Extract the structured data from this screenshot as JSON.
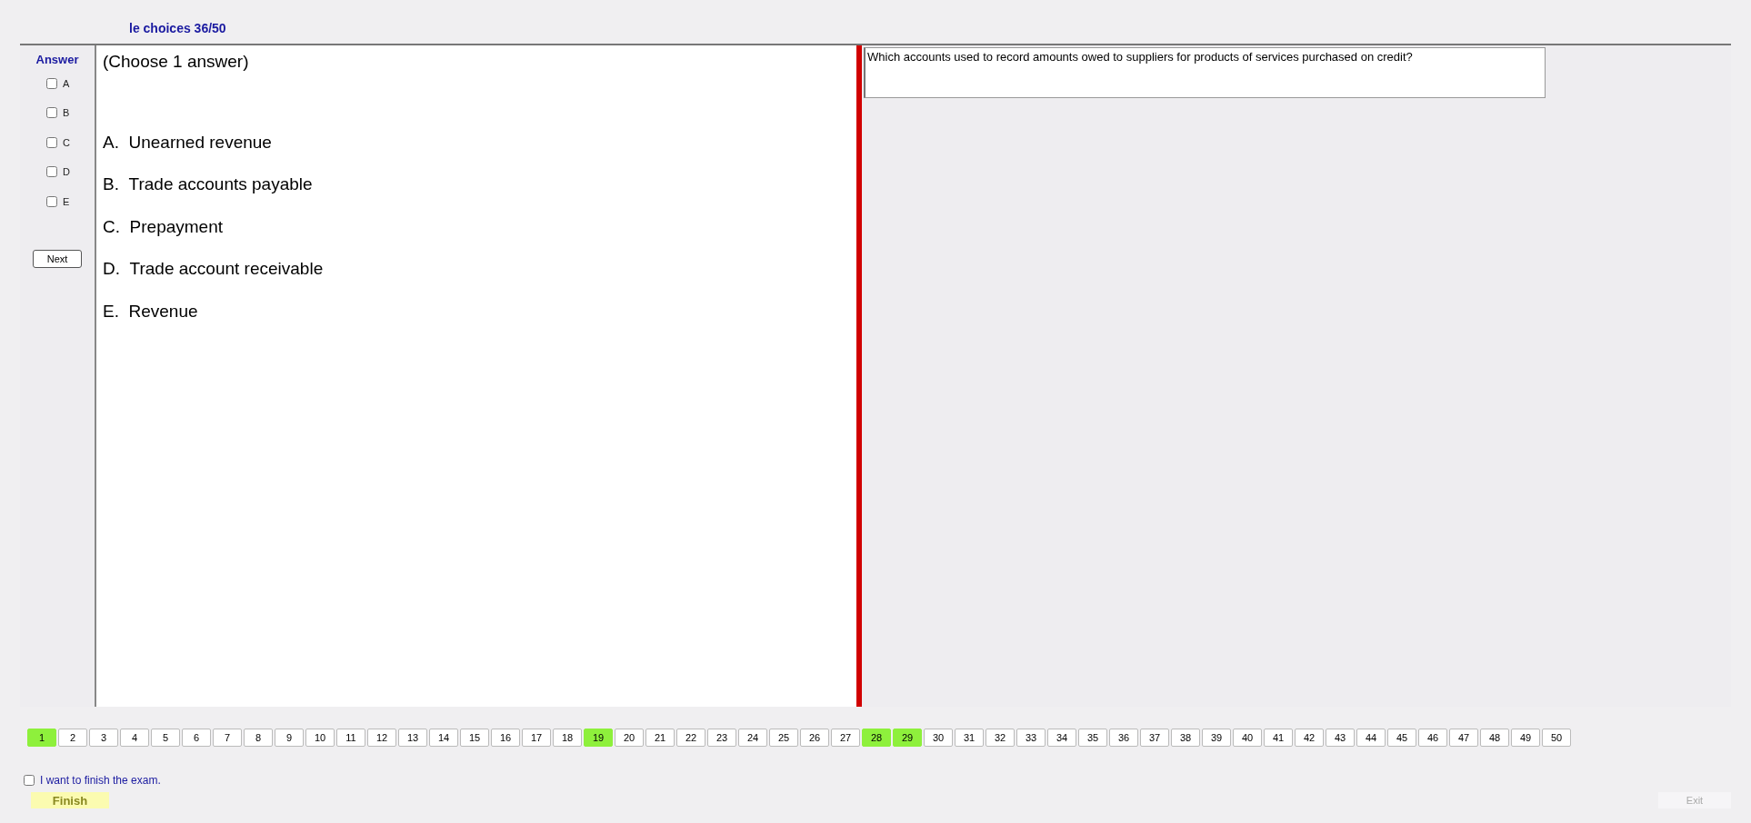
{
  "header": {
    "title": "le choices 36/50"
  },
  "answer_panel": {
    "title": "Answer",
    "options": [
      {
        "label": "A",
        "checked": false
      },
      {
        "label": "B",
        "checked": false
      },
      {
        "label": "C",
        "checked": false
      },
      {
        "label": "D",
        "checked": false
      },
      {
        "label": "E",
        "checked": false
      }
    ],
    "next_button": "Next"
  },
  "choices_panel": {
    "instruction": "(Choose 1 answer)",
    "choices": [
      {
        "letter": "A.",
        "text": "Unearned revenue"
      },
      {
        "letter": "B.",
        "text": "Trade accounts payable"
      },
      {
        "letter": "C.",
        "text": "Prepayment"
      },
      {
        "letter": "D.",
        "text": "Trade account receivable"
      },
      {
        "letter": "E.",
        "text": "Revenue"
      }
    ]
  },
  "question": "Which accounts used to record amounts owed to suppliers for products of services purchased on credit?",
  "pages": [
    {
      "label": "1",
      "answered": true
    },
    {
      "label": "2",
      "answered": false
    },
    {
      "label": "3",
      "answered": false
    },
    {
      "label": "4",
      "answered": false
    },
    {
      "label": "5",
      "answered": false
    },
    {
      "label": "6",
      "answered": false
    },
    {
      "label": "7",
      "answered": false
    },
    {
      "label": "8",
      "answered": false
    },
    {
      "label": "9",
      "answered": false
    },
    {
      "label": "10",
      "answered": false
    },
    {
      "label": "11",
      "answered": false
    },
    {
      "label": "12",
      "answered": false
    },
    {
      "label": "13",
      "answered": false
    },
    {
      "label": "14",
      "answered": false
    },
    {
      "label": "15",
      "answered": false
    },
    {
      "label": "16",
      "answered": false
    },
    {
      "label": "17",
      "answered": false
    },
    {
      "label": "18",
      "answered": false
    },
    {
      "label": "19",
      "answered": true
    },
    {
      "label": "20",
      "answered": false
    },
    {
      "label": "21",
      "answered": false
    },
    {
      "label": "22",
      "answered": false
    },
    {
      "label": "23",
      "answered": false
    },
    {
      "label": "24",
      "answered": false
    },
    {
      "label": "25",
      "answered": false
    },
    {
      "label": "26",
      "answered": false
    },
    {
      "label": "27",
      "answered": false
    },
    {
      "label": "28",
      "answered": true
    },
    {
      "label": "29",
      "answered": true
    },
    {
      "label": "30",
      "answered": false
    },
    {
      "label": "31",
      "answered": false
    },
    {
      "label": "32",
      "answered": false
    },
    {
      "label": "33",
      "answered": false
    },
    {
      "label": "34",
      "answered": false
    },
    {
      "label": "35",
      "answered": false
    },
    {
      "label": "36",
      "answered": false
    },
    {
      "label": "37",
      "answered": false
    },
    {
      "label": "38",
      "answered": false
    },
    {
      "label": "39",
      "answered": false
    },
    {
      "label": "40",
      "answered": false
    },
    {
      "label": "41",
      "answered": false
    },
    {
      "label": "42",
      "answered": false
    },
    {
      "label": "43",
      "answered": false
    },
    {
      "label": "44",
      "answered": false
    },
    {
      "label": "45",
      "answered": false
    },
    {
      "label": "46",
      "answered": false
    },
    {
      "label": "47",
      "answered": false
    },
    {
      "label": "48",
      "answered": false
    },
    {
      "label": "49",
      "answered": false
    },
    {
      "label": "50",
      "answered": false
    }
  ],
  "finish": {
    "confirm_label": "I want to finish the exam.",
    "confirm_checked": false,
    "finish_button": "Finish",
    "exit_button": "Exit",
    "exit_disabled": true
  }
}
